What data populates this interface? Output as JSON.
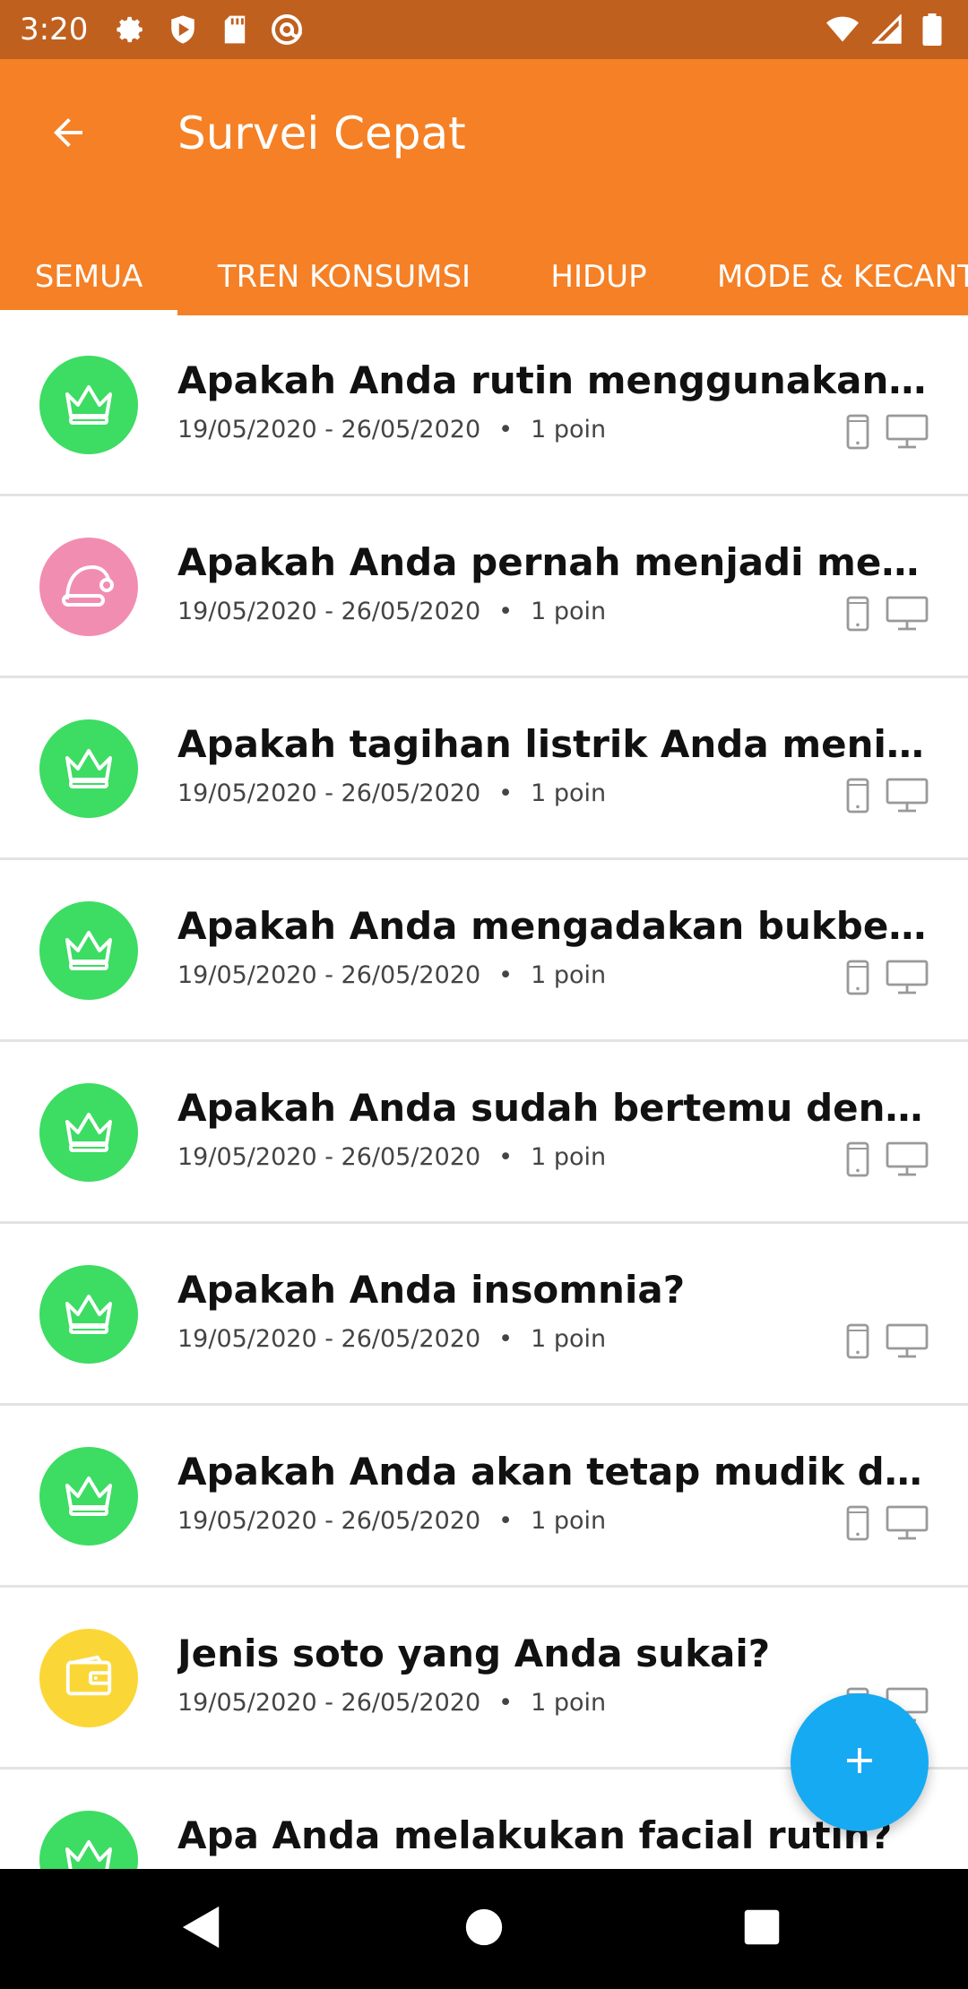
{
  "status_bar": {
    "time": "3:20",
    "left_icons": [
      "gear-icon",
      "shield-play-icon",
      "sd-card-icon",
      "at-sign-icon"
    ],
    "right_icons": [
      "wifi-icon",
      "cell-signal-icon",
      "battery-icon"
    ]
  },
  "app_bar": {
    "title": "Survei Cepat",
    "back_icon": "arrow-left-icon"
  },
  "tabs": [
    {
      "label": "SEMUA",
      "selected": true
    },
    {
      "label": "TREN KONSUMSI",
      "selected": false
    },
    {
      "label": "HIDUP",
      "selected": false
    },
    {
      "label": "MODE & KECANTIKAN",
      "selected": false
    }
  ],
  "surveys": [
    {
      "title": "Apakah Anda rutin menggunakan scrub...",
      "dates": "19/05/2020 - 26/05/2020",
      "points": "1 poin",
      "icon": "crown-icon",
      "color": "#3ddc63"
    },
    {
      "title": "Apakah Anda pernah menjadi member k...",
      "dates": "19/05/2020 - 26/05/2020",
      "points": "1 poin",
      "icon": "santa-hat-icon",
      "color": "#f28db2"
    },
    {
      "title": "Apakah tagihan listrik Anda meningkat...",
      "dates": "19/05/2020 - 26/05/2020",
      "points": "1 poin",
      "icon": "crown-icon",
      "color": "#3ddc63"
    },
    {
      "title": "Apakah Anda mengadakan bukber di lua...",
      "dates": "19/05/2020 - 26/05/2020",
      "points": "1 poin",
      "icon": "crown-icon",
      "color": "#3ddc63"
    },
    {
      "title": "Apakah Anda sudah bertemu dengan jo...",
      "dates": "19/05/2020 - 26/05/2020",
      "points": "1 poin",
      "icon": "crown-icon",
      "color": "#3ddc63"
    },
    {
      "title": "Apakah Anda insomnia?",
      "dates": "19/05/2020 - 26/05/2020",
      "points": "1 poin",
      "icon": "crown-icon",
      "color": "#3ddc63"
    },
    {
      "title": "Apakah Anda akan tetap mudik di tenga...",
      "dates": "19/05/2020 - 26/05/2020",
      "points": "1 poin",
      "icon": "crown-icon",
      "color": "#3ddc63"
    },
    {
      "title": "Jenis soto yang Anda sukai?",
      "dates": "19/05/2020 - 26/05/2020",
      "points": "1 poin",
      "icon": "wallet-icon",
      "color": "#fbd637"
    },
    {
      "title": "Apa Anda melakukan facial rutin?",
      "dates": "",
      "points": "",
      "icon": "crown-icon",
      "color": "#3ddc63"
    }
  ],
  "meta_separator": "•",
  "device_icons": [
    "phone-icon",
    "monitor-icon"
  ],
  "fab_icon": "plus-icon",
  "nav_bar": [
    "back-triangle-icon",
    "home-circle-icon",
    "recents-square-icon"
  ],
  "colors": {
    "status_bar": "#c0601f",
    "app_bar": "#f58025",
    "fab": "#16aaf3"
  }
}
